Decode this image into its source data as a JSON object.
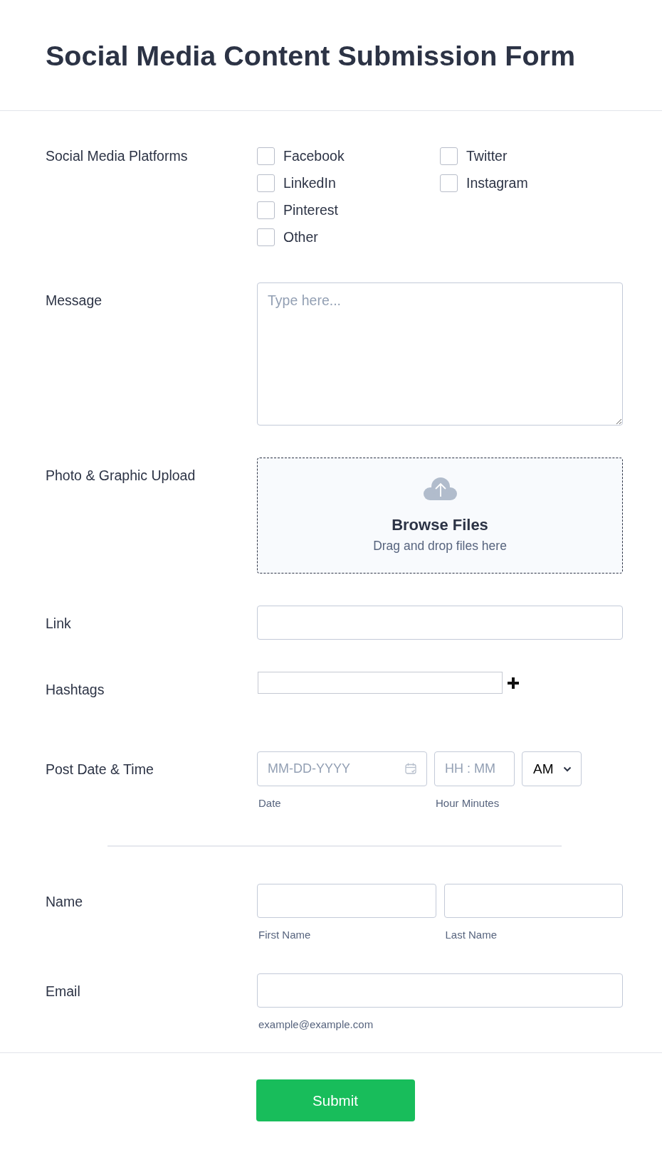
{
  "title": "Social Media Content Submission Form",
  "fields": [
    {
      "kind": "checkboxes",
      "label": "Social Media Platforms",
      "columns": [
        {
          "options": [
            {
              "label": "Facebook",
              "checked": false
            },
            {
              "label": "LinkedIn",
              "checked": false
            },
            {
              "label": "Pinterest",
              "checked": false
            },
            {
              "label": "Other",
              "checked": false
            }
          ]
        },
        {
          "options": [
            {
              "label": "Twitter",
              "checked": false
            },
            {
              "label": "Instagram",
              "checked": false
            }
          ]
        }
      ]
    },
    {
      "kind": "textarea",
      "label": "Message",
      "placeholder": "Type here..."
    },
    {
      "kind": "upload",
      "label": "Photo & Graphic Upload",
      "title": "Browse Files",
      "hint": "Drag and drop files here"
    },
    {
      "kind": "text",
      "label": "Link"
    },
    {
      "kind": "hashtags",
      "label": "Hashtags"
    },
    {
      "kind": "datetime",
      "label": "Post Date & Time",
      "date": {
        "placeholder": "MM-DD-YYYY",
        "sublabel": "Date"
      },
      "time": {
        "placeholder": "HH : MM",
        "sublabel": "Hour Minutes"
      },
      "period": {
        "value": "AM"
      }
    },
    {
      "kind": "divider"
    },
    {
      "kind": "split",
      "label": "Name",
      "parts": [
        {
          "sublabel": "First Name"
        },
        {
          "sublabel": "Last Name"
        }
      ]
    },
    {
      "kind": "text",
      "label": "Email",
      "sublabel": "example@example.com"
    }
  ],
  "submit": {
    "label": "Submit"
  }
}
